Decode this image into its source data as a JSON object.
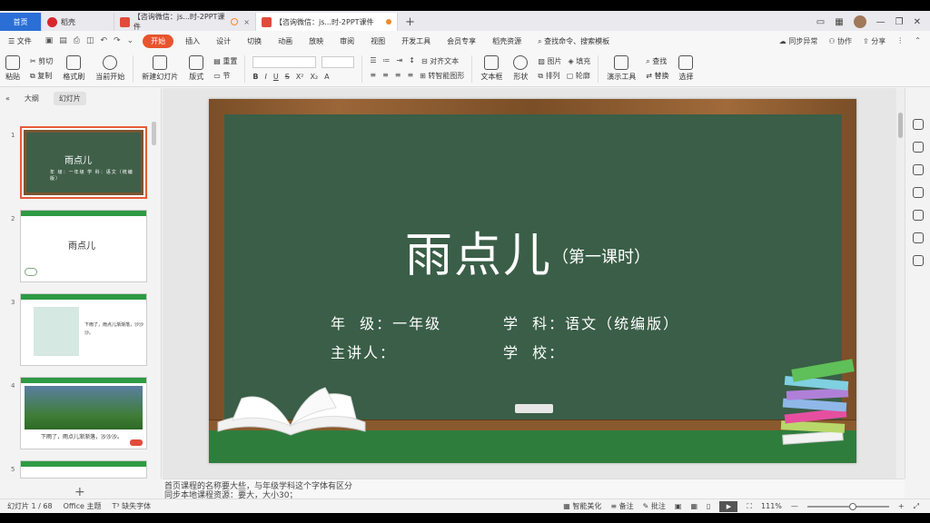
{
  "tabs": [
    {
      "label": "首页"
    },
    {
      "label": "稻壳"
    },
    {
      "label": "【咨询微信：js...时-2PPT课件"
    },
    {
      "label": "【咨询微信：js...时-2PPT课件"
    }
  ],
  "menu": {
    "file": "文件",
    "items": [
      "开始",
      "插入",
      "设计",
      "切换",
      "动画",
      "放映",
      "审阅",
      "视图",
      "开发工具",
      "会员专享",
      "稻壳资源"
    ],
    "search": "查找命令、搜索模板",
    "sync": "同步异常",
    "collab": "协作",
    "share": "分享"
  },
  "ribbon": {
    "paste": "粘贴",
    "cut": "剪切",
    "copy": "复制",
    "format_painter": "格式刷",
    "from_current": "当前开始",
    "new_slide": "新建幻灯片",
    "layout": "版式",
    "reset": "重置",
    "section": "节",
    "align_text": "对齐文本",
    "convert_smartart": "转智能图形",
    "textbox": "文本框",
    "shape": "形状",
    "picture": "图片",
    "fill": "填充",
    "arrange": "排列",
    "outline": "轮廓",
    "presenter": "演示工具",
    "find": "查找",
    "replace": "替换",
    "select": "选择"
  },
  "left_panel": {
    "outline_tab": "大纲",
    "slides_tab": "幻灯片",
    "thumbs": [
      {
        "num": "1",
        "title": "雨点儿",
        "lines": "年 级：一年级   学 科：语文（统编版）"
      },
      {
        "num": "2",
        "title": "雨点儿"
      },
      {
        "num": "3",
        "text": "下雨了，雨点儿渐渐落，沙沙沙。"
      },
      {
        "num": "4",
        "text": "下雨了，雨点儿渐渐落，沙沙沙。"
      },
      {
        "num": "5"
      }
    ]
  },
  "slide": {
    "title": "雨点儿",
    "subtitle": "（第一课时）",
    "grade": "年  级：一年级",
    "subject": "学  科：语文（统编版）",
    "speaker": "主讲人：",
    "school": "学  校："
  },
  "notes": {
    "line1": "首页课程的名称要大些，与年级学科这个字体有区分",
    "line2": "同步本地课程资源：要大，大小30；"
  },
  "status": {
    "slide_count": "幻灯片 1 / 68",
    "theme": "Office 主题",
    "missing_font": "缺失字体",
    "beautify": "智能美化",
    "remarks": "备注",
    "comments": "批注",
    "zoom": "111%"
  }
}
